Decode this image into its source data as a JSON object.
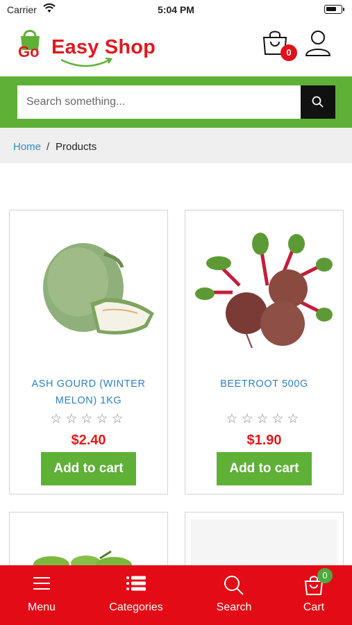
{
  "status_bar": {
    "carrier": "Carrier",
    "time": "5:04 PM"
  },
  "header": {
    "logo_prefix": "Go",
    "logo_text": "Easy Shop",
    "cart_count": "0",
    "icons": {
      "cart": "shopping-bag-icon",
      "user": "user-icon"
    }
  },
  "search": {
    "placeholder": "Search something...",
    "value": "",
    "icon": "search-icon"
  },
  "breadcrumb": {
    "home": "Home",
    "separator": "/",
    "current": "Products"
  },
  "products": [
    {
      "name": "ASH GOURD (WINTER MELON) 1KG",
      "price": "$2.40",
      "rating": 0,
      "stars": "☆☆☆☆☆",
      "button": "Add to cart"
    },
    {
      "name": "BEETROOT 500G",
      "price": "$1.90",
      "rating": 0,
      "stars": "☆☆☆☆☆",
      "button": "Add to cart"
    }
  ],
  "bottom_nav": {
    "items": [
      {
        "label": "Menu",
        "icon": "hamburger-icon"
      },
      {
        "label": "Categories",
        "icon": "list-icon"
      },
      {
        "label": "Search",
        "icon": "search-icon"
      },
      {
        "label": "Cart",
        "icon": "shopping-bag-icon"
      }
    ],
    "cart_count": "0"
  },
  "colors": {
    "brand_red": "#e1181f",
    "brand_green": "#5fb036",
    "link_blue": "#2f7fc0",
    "price_red": "#e01b1b"
  }
}
